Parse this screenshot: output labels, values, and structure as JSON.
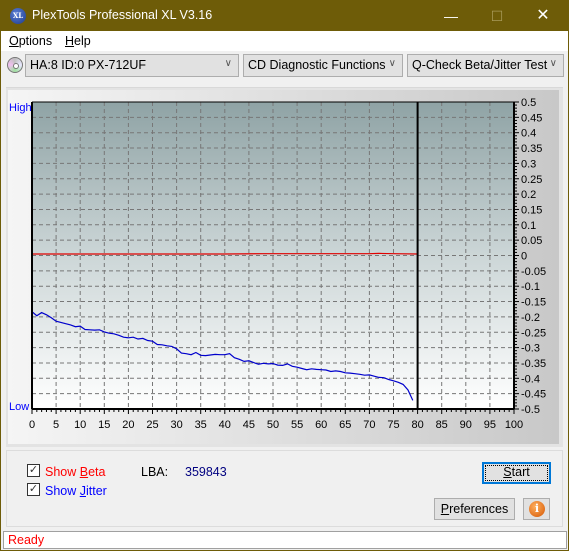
{
  "window": {
    "title": "PlexTools Professional XL V3.16",
    "app_icon_text": "XL",
    "minimize_glyph": "—",
    "maximize_glyph": "☐",
    "close_glyph": "✕"
  },
  "menu": {
    "items": [
      {
        "label": "Options",
        "mnemonic": "O",
        "rest": "ptions"
      },
      {
        "label": "Help",
        "mnemonic": "H",
        "rest": "elp"
      }
    ]
  },
  "toolbar": {
    "drive": "HA:8 ID:0  PX-712UF",
    "function": "CD Diagnostic Functions",
    "test": "Q-Check Beta/Jitter Test",
    "chevron": "∨"
  },
  "chart_labels": {
    "high": "High",
    "low": "Low"
  },
  "chart_data": {
    "type": "line",
    "title": "",
    "xlabel": "",
    "ylabel": "",
    "xlim": [
      0,
      100
    ],
    "ylim": [
      -0.5,
      0.5
    ],
    "grid": true,
    "x_ticks": [
      0,
      5,
      10,
      15,
      20,
      25,
      30,
      35,
      40,
      45,
      50,
      55,
      60,
      65,
      70,
      75,
      80,
      85,
      90,
      95,
      100
    ],
    "y_ticks": [
      "0.5",
      "0.45",
      "0.4",
      "0.35",
      "0.3",
      "0.25",
      "0.2",
      "0.15",
      "0.1",
      "0.05",
      "0",
      "-0.05",
      "-0.1",
      "-0.15",
      "-0.2",
      "-0.25",
      "-0.3",
      "-0.35",
      "-0.4",
      "-0.45",
      "-0.5"
    ],
    "disc_end_marker": 80,
    "series": [
      {
        "name": "Beta",
        "color": "#e00000",
        "x": [
          0,
          10,
          20,
          30,
          40,
          48,
          50,
          60,
          70,
          72,
          75,
          80
        ],
        "y": [
          0.005,
          0.005,
          0.005,
          0.005,
          0.005,
          0.006,
          0.006,
          0.006,
          0.006,
          0.007,
          0.006,
          0.005
        ]
      },
      {
        "name": "Jitter",
        "color": "#0000cc",
        "x": [
          0,
          1,
          2,
          3,
          4,
          5,
          6,
          7,
          8,
          9,
          10,
          11,
          12,
          13,
          14,
          15,
          16,
          17,
          18,
          19,
          20,
          21,
          22,
          23,
          24,
          25,
          26,
          27,
          28,
          29,
          30,
          31,
          32,
          33,
          34,
          35,
          36,
          37,
          38,
          39,
          40,
          41,
          42,
          43,
          44,
          45,
          46,
          47,
          48,
          49,
          50,
          51,
          52,
          53,
          54,
          55,
          56,
          57,
          58,
          59,
          60,
          61,
          62,
          63,
          64,
          65,
          66,
          67,
          68,
          69,
          70,
          71,
          72,
          73,
          74,
          75,
          76,
          77,
          78,
          79
        ],
        "y": [
          -0.183,
          -0.196,
          -0.186,
          -0.193,
          -0.203,
          -0.214,
          -0.218,
          -0.222,
          -0.226,
          -0.232,
          -0.23,
          -0.241,
          -0.242,
          -0.243,
          -0.242,
          -0.249,
          -0.253,
          -0.255,
          -0.26,
          -0.266,
          -0.268,
          -0.266,
          -0.272,
          -0.27,
          -0.277,
          -0.279,
          -0.29,
          -0.291,
          -0.294,
          -0.296,
          -0.304,
          -0.318,
          -0.32,
          -0.323,
          -0.316,
          -0.325,
          -0.326,
          -0.324,
          -0.322,
          -0.323,
          -0.323,
          -0.32,
          -0.333,
          -0.338,
          -0.345,
          -0.343,
          -0.349,
          -0.354,
          -0.351,
          -0.353,
          -0.352,
          -0.357,
          -0.358,
          -0.353,
          -0.361,
          -0.364,
          -0.368,
          -0.372,
          -0.369,
          -0.371,
          -0.372,
          -0.373,
          -0.378,
          -0.376,
          -0.378,
          -0.382,
          -0.383,
          -0.385,
          -0.387,
          -0.39,
          -0.389,
          -0.393,
          -0.397,
          -0.398,
          -0.404,
          -0.408,
          -0.413,
          -0.42,
          -0.438,
          -0.472
        ]
      }
    ]
  },
  "options": {
    "show_beta": {
      "label": "Show Beta",
      "prefix": "Show ",
      "mnemonic": "B",
      "rest": "eta",
      "checked": true,
      "color": "#ff0000"
    },
    "show_jitter": {
      "label": "Show Jitter",
      "prefix": "Show ",
      "mnemonic": "J",
      "rest": "itter",
      "checked": true,
      "color": "#0000ff"
    },
    "check_glyph": "✓"
  },
  "lba": {
    "label": "LBA:",
    "value": "359843"
  },
  "buttons": {
    "start": {
      "label": "Start",
      "mnemonic": "S",
      "rest": "tart"
    },
    "preferences": {
      "label": "Preferences",
      "mnemonic": "P",
      "rest": "references"
    },
    "info_glyph": "i"
  },
  "status": {
    "text": "Ready"
  }
}
